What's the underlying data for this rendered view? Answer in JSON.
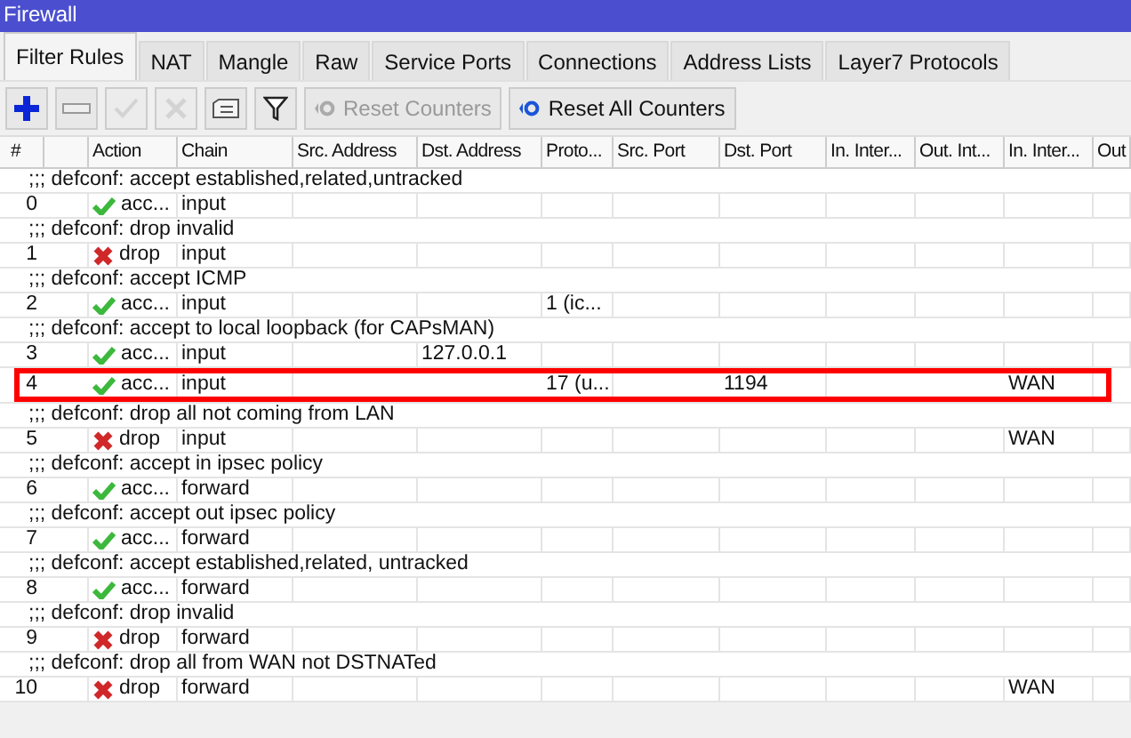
{
  "window": {
    "title": "Firewall"
  },
  "tabs": [
    {
      "label": "Filter Rules",
      "selected": true
    },
    {
      "label": "NAT",
      "selected": false
    },
    {
      "label": "Mangle",
      "selected": false
    },
    {
      "label": "Raw",
      "selected": false
    },
    {
      "label": "Service Ports",
      "selected": false
    },
    {
      "label": "Connections",
      "selected": false
    },
    {
      "label": "Address Lists",
      "selected": false
    },
    {
      "label": "Layer7 Protocols",
      "selected": false
    }
  ],
  "toolbar": {
    "icon_buttons": [
      {
        "kind": "add",
        "disabled": false
      },
      {
        "kind": "remove",
        "disabled": false
      },
      {
        "kind": "enable",
        "disabled": true
      },
      {
        "kind": "disable",
        "disabled": true
      },
      {
        "kind": "comment",
        "disabled": false
      },
      {
        "kind": "filter",
        "disabled": false
      }
    ],
    "buttons": [
      {
        "label": "Reset Counters",
        "disabled": true
      },
      {
        "label": "Reset All Counters",
        "disabled": false
      }
    ]
  },
  "table": {
    "columns": [
      "#",
      "Action",
      "Chain",
      "Src. Address",
      "Dst. Address",
      "Proto...",
      "Src. Port",
      "Dst. Port",
      "In. Inter...",
      "Out. Int...",
      "In. Inter...",
      "Out"
    ],
    "rows": [
      {
        "kind": "comment",
        "text": ";;; defconf: accept established,related,untracked"
      },
      {
        "kind": "rule",
        "number": "0",
        "action": {
          "kind": "accept",
          "label": "acc..."
        },
        "chain": "input",
        "highlighted": false
      },
      {
        "kind": "comment",
        "text": ";;; defconf: drop invalid"
      },
      {
        "kind": "rule",
        "number": "1",
        "action": {
          "kind": "drop",
          "label": "drop"
        },
        "chain": "input",
        "highlighted": false
      },
      {
        "kind": "comment",
        "text": ";;; defconf: accept ICMP"
      },
      {
        "kind": "rule",
        "number": "2",
        "action": {
          "kind": "accept",
          "label": "acc..."
        },
        "chain": "input",
        "protocol": "1 (ic...",
        "highlighted": false
      },
      {
        "kind": "comment",
        "text": ";;; defconf: accept to local loopback (for CAPsMAN)"
      },
      {
        "kind": "rule",
        "number": "3",
        "action": {
          "kind": "accept",
          "label": "acc..."
        },
        "chain": "input",
        "dst_address": "127.0.0.1",
        "highlighted": false
      },
      {
        "kind": "rule",
        "number": "4",
        "action": {
          "kind": "accept",
          "label": "acc..."
        },
        "chain": "input",
        "protocol": "17 (u...",
        "dst_port": "1194",
        "in_interface_list": "WAN",
        "highlighted": true
      },
      {
        "kind": "comment",
        "text": ";;; defconf: drop all not coming from LAN"
      },
      {
        "kind": "rule",
        "number": "5",
        "action": {
          "kind": "drop",
          "label": "drop"
        },
        "chain": "input",
        "in_interface_list": "WAN",
        "highlighted": false
      },
      {
        "kind": "comment",
        "text": ";;; defconf: accept in ipsec policy"
      },
      {
        "kind": "rule",
        "number": "6",
        "action": {
          "kind": "accept",
          "label": "acc..."
        },
        "chain": "forward",
        "highlighted": false
      },
      {
        "kind": "comment",
        "text": ";;; defconf: accept out ipsec policy"
      },
      {
        "kind": "rule",
        "number": "7",
        "action": {
          "kind": "accept",
          "label": "acc..."
        },
        "chain": "forward",
        "highlighted": false
      },
      {
        "kind": "comment",
        "text": ";;; defconf: accept established,related, untracked"
      },
      {
        "kind": "rule",
        "number": "8",
        "action": {
          "kind": "accept",
          "label": "acc..."
        },
        "chain": "forward",
        "highlighted": false
      },
      {
        "kind": "comment",
        "text": ";;; defconf: drop invalid"
      },
      {
        "kind": "rule",
        "number": "9",
        "action": {
          "kind": "drop",
          "label": "drop"
        },
        "chain": "forward",
        "highlighted": false
      },
      {
        "kind": "comment",
        "text": ";;; defconf: drop all from WAN not DSTNATed"
      },
      {
        "kind": "rule",
        "number": "10",
        "action": {
          "kind": "drop",
          "label": "drop"
        },
        "chain": "forward",
        "in_interface_list": "WAN",
        "highlighted": false
      }
    ]
  }
}
